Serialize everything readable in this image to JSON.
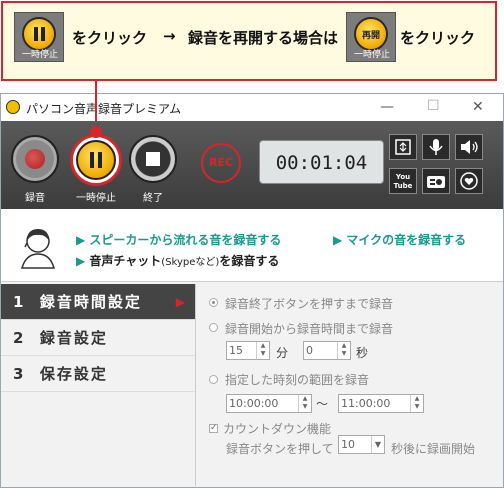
{
  "callout": {
    "pause_caption": "一時停止",
    "text1": "をクリック",
    "arrow": "→",
    "text2": "録音を再開する場合は",
    "resume_icon_label": "再開",
    "resume_caption": "一時停止",
    "text3": "をクリック"
  },
  "window": {
    "title": "パソコン音声録音プレミアム",
    "minimize": "—",
    "maximize": "☐",
    "close": "✕"
  },
  "controls": {
    "record_label": "録音",
    "pause_label": "一時停止",
    "stop_label": "終了",
    "rec_indicator": "REC",
    "timer": "00:01:04",
    "tools": [
      "window-icon",
      "microphone-icon",
      "speaker-icon",
      "youtube-icon",
      "radio-icon",
      "heart-icon"
    ],
    "youtube_text": "You Tube"
  },
  "info": {
    "link1": "スピーカーから流れる音を録音する",
    "link2": "マイクの音を録音する",
    "link3": "音声チャット",
    "link3_sub": "(Skypeなど)",
    "link3_tail": "を録音する"
  },
  "nav": [
    {
      "num": "1",
      "label": "録音時間設定"
    },
    {
      "num": "2",
      "label": "録音設定"
    },
    {
      "num": "3",
      "label": "保存設定"
    }
  ],
  "options": {
    "opt1": "録音終了ボタンを押すまで録音",
    "opt2": "録音開始から録音時間まで録音",
    "minutes_value": "15",
    "minutes_unit": "分",
    "seconds_value": "0",
    "seconds_unit": "秒",
    "opt3": "指定した時刻の範囲を録音",
    "start_time": "10:00:00",
    "range_sep": "～",
    "end_time": "11:00:00",
    "countdown_label": "カウントダウン機能",
    "countdown_prefix": "録音ボタンを押して",
    "countdown_value": "10",
    "countdown_suffix": "秒後に録画開始"
  },
  "colors": {
    "accent_red": "#d7262b",
    "link_teal": "#1a9a8a",
    "pause_yellow": "#f0a800"
  }
}
